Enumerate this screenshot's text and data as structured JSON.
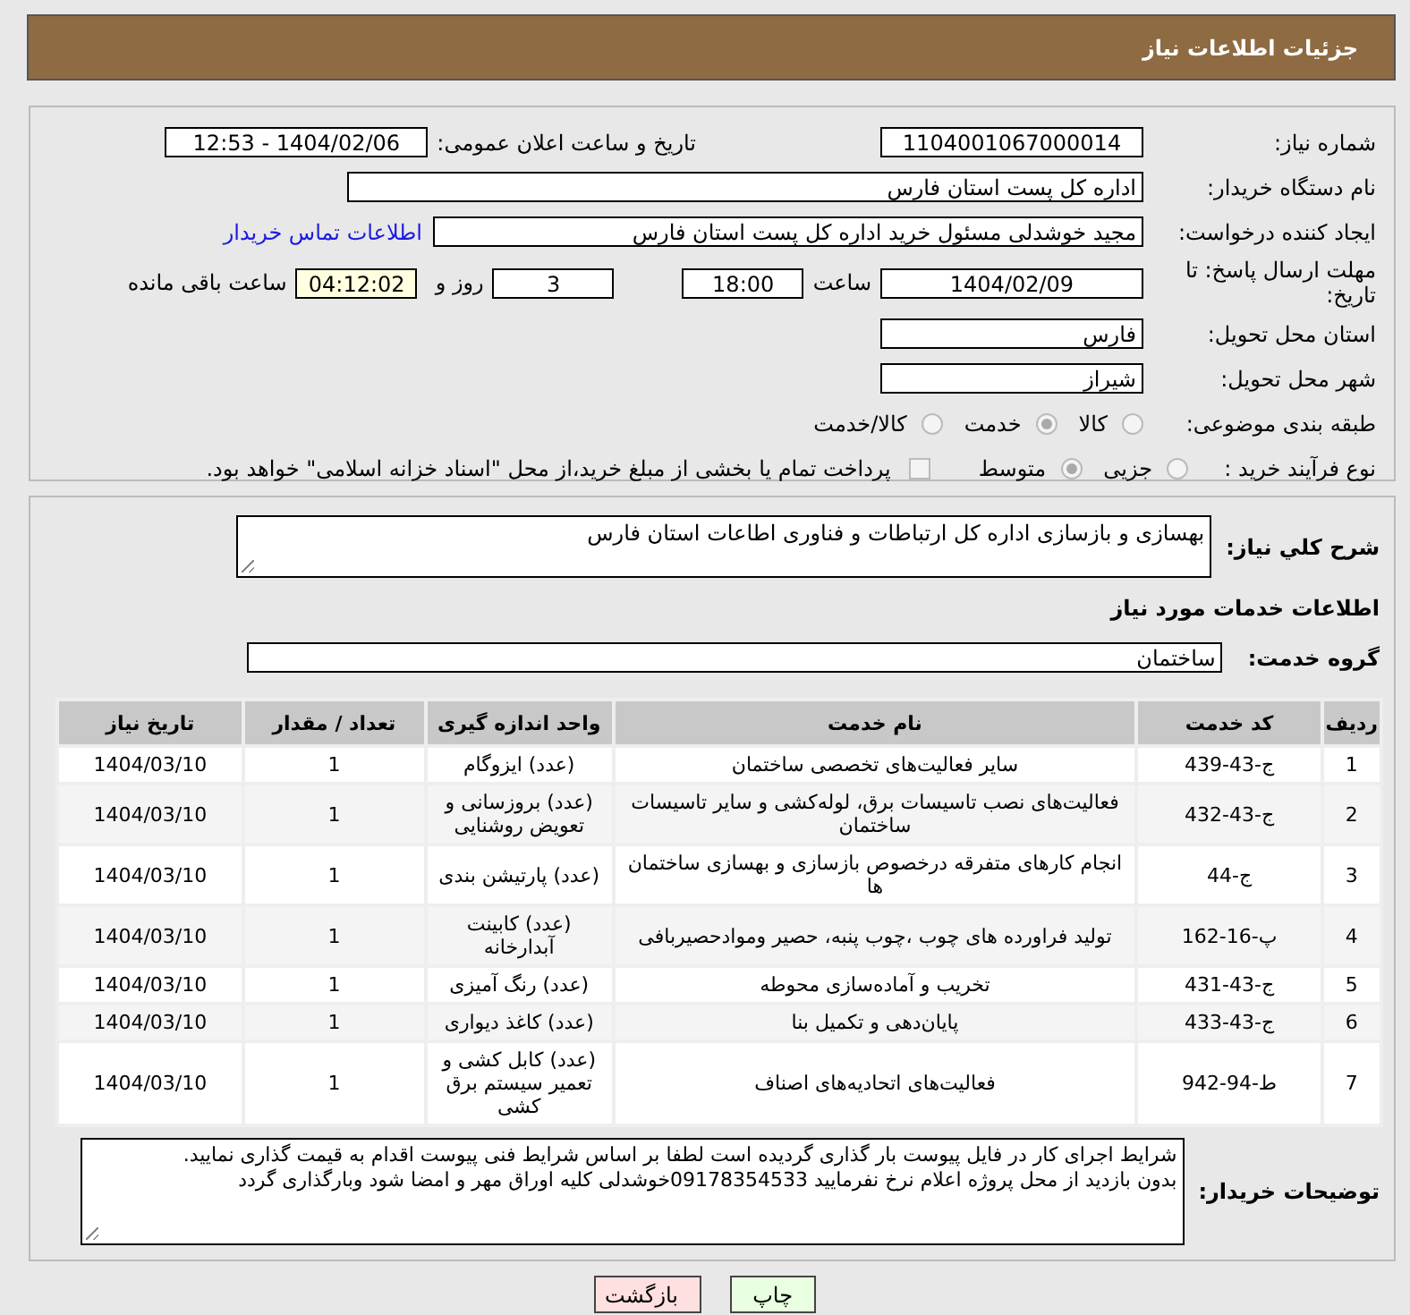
{
  "header": {
    "title": "جزئیات اطلاعات نیاز"
  },
  "need_number": {
    "label": "شماره نیاز:",
    "value": "1104001067000014"
  },
  "announce": {
    "label": "تاریخ و ساعت اعلان عمومی:",
    "value": "1404/02/06 - 12:53"
  },
  "buyer_org": {
    "label": "نام دستگاه خریدار:",
    "value": "اداره کل پست استان فارس"
  },
  "requester": {
    "label": "ایجاد کننده درخواست:",
    "value": "مجید خوشدلی مسئول خرید اداره کل پست استان فارس",
    "link": "اطلاعات تماس خریدار"
  },
  "deadline": {
    "label": "مهلت ارسال پاسخ: تا تاریخ:",
    "date": "1404/02/09",
    "time_label": "ساعت",
    "time": "18:00",
    "days": "3",
    "days_label": "روز و",
    "remaining": "04:12:02",
    "remaining_label": "ساعت باقی مانده"
  },
  "province": {
    "label": "استان محل تحویل:",
    "value": "فارس"
  },
  "city": {
    "label": "شهر محل تحویل:",
    "value": "شیراز"
  },
  "category": {
    "label": "طبقه بندی موضوعی:",
    "options": [
      {
        "label": "کالا",
        "selected": false
      },
      {
        "label": "خدمت",
        "selected": true
      },
      {
        "label": "کالا/خدمت",
        "selected": false
      }
    ]
  },
  "process": {
    "label": "نوع فرآیند خرید :",
    "options": [
      {
        "label": "جزیی",
        "selected": false
      },
      {
        "label": "متوسط",
        "selected": true
      }
    ],
    "payment_checkbox": {
      "label": "پرداخت تمام یا بخشی از مبلغ خرید،از محل \"اسناد خزانه اسلامی\" خواهد بود.",
      "checked": false
    }
  },
  "description": {
    "label": "شرح کلي نیاز:",
    "value": "بهسازی و بازسازی اداره کل ارتباطات و فناوری اطاعات استان فارس"
  },
  "services_heading": "اطلاعات خدمات مورد نیاز",
  "service_group": {
    "label": "گروه خدمت:",
    "value": "ساختمان"
  },
  "table": {
    "columns": [
      "ردیف",
      "کد خدمت",
      "نام خدمت",
      "واحد اندازه گیری",
      "تعداد / مقدار",
      "تاریخ نیاز"
    ],
    "rows": [
      [
        "1",
        "ج-43-439",
        "سایر فعالیت‌های تخصصی ساختمان",
        "(عدد) ایزوگام",
        "1",
        "1404/03/10"
      ],
      [
        "2",
        "ج-43-432",
        "فعالیت‌های نصب تاسیسات برق، لوله‌کشی و سایر تاسیسات ساختمان",
        "(عدد) بروزسانی و تعویض روشنایی",
        "1",
        "1404/03/10"
      ],
      [
        "3",
        "ج-44",
        "انجام کارهای متفرقه درخصوص بازسازی و بهسازی ساختمان ها",
        "(عدد) پارتیشن بندی",
        "1",
        "1404/03/10"
      ],
      [
        "4",
        "پ-16-162",
        "تولید فراورده های چوب ،چوب پنبه، حصیر وموادحصیربافی",
        "(عدد) کابینت آبدارخانه",
        "1",
        "1404/03/10"
      ],
      [
        "5",
        "ج-43-431",
        "تخریب و آماده‌سازی محوطه",
        "(عدد) رنگ آمیزی",
        "1",
        "1404/03/10"
      ],
      [
        "6",
        "ج-43-433",
        "پایان‌دهی و تکمیل بنا",
        "(عدد) کاغذ دیواری",
        "1",
        "1404/03/10"
      ],
      [
        "7",
        "ط-94-942",
        "فعالیت‌های اتحادیه‌های اصناف",
        "(عدد) کابل کشی و تعمیر سیستم برق کشی",
        "1",
        "1404/03/10"
      ]
    ]
  },
  "buyer_notes": {
    "label": "توضیحات خریدار:",
    "lines": [
      "شرایط اجرای کار در فایل پیوست بار گذاری گردیده است لطفا بر اساس شرایط فنی پیوست اقدام به قیمت گذاری نمایید.",
      "بدون بازدید از محل پروژه اعلام نرخ نفرمایید 09178354533خوشدلی کلیه اوراق مهر و امضا شود وبارگذاری گردد"
    ]
  },
  "buttons": [
    {
      "label": "چاپ",
      "kind": "print"
    },
    {
      "label": "بازگشت",
      "kind": "back"
    }
  ]
}
